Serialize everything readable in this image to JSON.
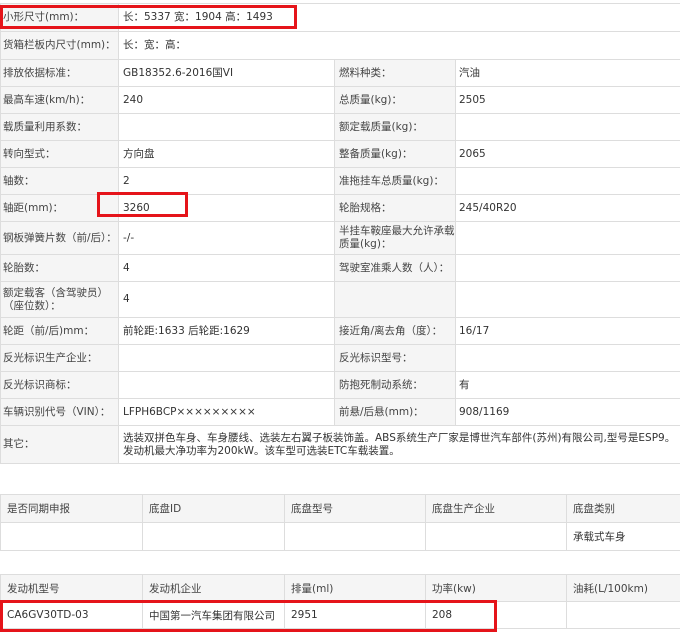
{
  "spec": {
    "rows": [
      {
        "type": "span",
        "label": "外形尺寸(mm)：",
        "label_shown": "小形尺寸(mm)：",
        "value": "长：5337 宽：1904 高：1493"
      },
      {
        "type": "span",
        "label": "货箱栏板内尺寸(mm)：",
        "value": "长：宽：高："
      },
      {
        "type": "pair",
        "label1": "排放依据标准：",
        "value1": "GB18352.6-2016国VI",
        "label2": "燃料种类：",
        "value2": "汽油"
      },
      {
        "type": "pair",
        "label1": "最高车速(km/h)：",
        "value1": "240",
        "label2": "总质量(kg)：",
        "value2": "2505"
      },
      {
        "type": "pair",
        "label1": "载质量利用系数：",
        "value1": "",
        "label2": "额定载质量(kg)：",
        "value2": ""
      },
      {
        "type": "pair",
        "label1": "转向型式：",
        "value1": "方向盘",
        "label2": "整备质量(kg)：",
        "value2": "2065"
      },
      {
        "type": "pair",
        "label1": "轴数：",
        "value1": "2",
        "label2": "准拖挂车总质量(kg)：",
        "value2": ""
      },
      {
        "type": "pair",
        "label1": "轴距(mm)：",
        "value1": "3260",
        "label2": "轮胎规格：",
        "value2": "245/40R20"
      },
      {
        "type": "pair",
        "label1": "钢板弹簧片数（前/后）：",
        "value1": "-/-",
        "label2": "半挂车鞍座最大允许承载质量(kg)：",
        "value2": ""
      },
      {
        "type": "pair",
        "label1": "轮胎数：",
        "value1": "4",
        "label2": "驾驶室准乘人数（人）：",
        "value2": ""
      },
      {
        "type": "pair",
        "label1": "额定载客（含驾驶员）（座位数）：",
        "value1": "4",
        "label2": "",
        "value2": ""
      },
      {
        "type": "pair",
        "label1": "轮距（前/后)mm：",
        "value1": "前轮距:1633 后轮距:1629",
        "label2": "接近角/离去角（度）：",
        "value2": "16/17"
      },
      {
        "type": "pair",
        "label1": "反光标识生产企业：",
        "value1": "",
        "label2": "反光标识型号：",
        "value2": ""
      },
      {
        "type": "pair",
        "label1": "反光标识商标：",
        "value1": "",
        "label2": "防抱死制动系统：",
        "value2": "有"
      },
      {
        "type": "pair",
        "label1": "车辆识别代号（VIN）：",
        "value1": "LFPH6BCP×××××××××",
        "label2": "前悬/后悬(mm)：",
        "value2": "908/1169"
      },
      {
        "type": "span",
        "label": "其它：",
        "value": "选装双拼色车身、车身腰线、选装左右翼子板装饰盖。ABS系统生产厂家是博世汽车部件(苏州)有限公司,型号是ESP9。发动机最大净功率为200kW。该车型可选装ETC车载装置。"
      }
    ]
  },
  "chassis": {
    "headers": [
      "是否同期申报",
      "底盘ID",
      "底盘型号",
      "底盘生产企业",
      "底盘类别"
    ],
    "row": [
      "",
      "",
      "",
      "",
      "承载式车身"
    ]
  },
  "engine": {
    "headers": [
      "发动机型号",
      "发动机企业",
      "排量(ml)",
      "功率(kw)",
      "油耗(L/100km)"
    ],
    "row": [
      "CA6GV30TD-03",
      "中国第一汽车集团有限公司",
      "2951",
      "208",
      ""
    ]
  },
  "colors": {
    "highlight": "#e5141a",
    "label_bg": "#f5f5f5",
    "border": "#dddddd"
  }
}
